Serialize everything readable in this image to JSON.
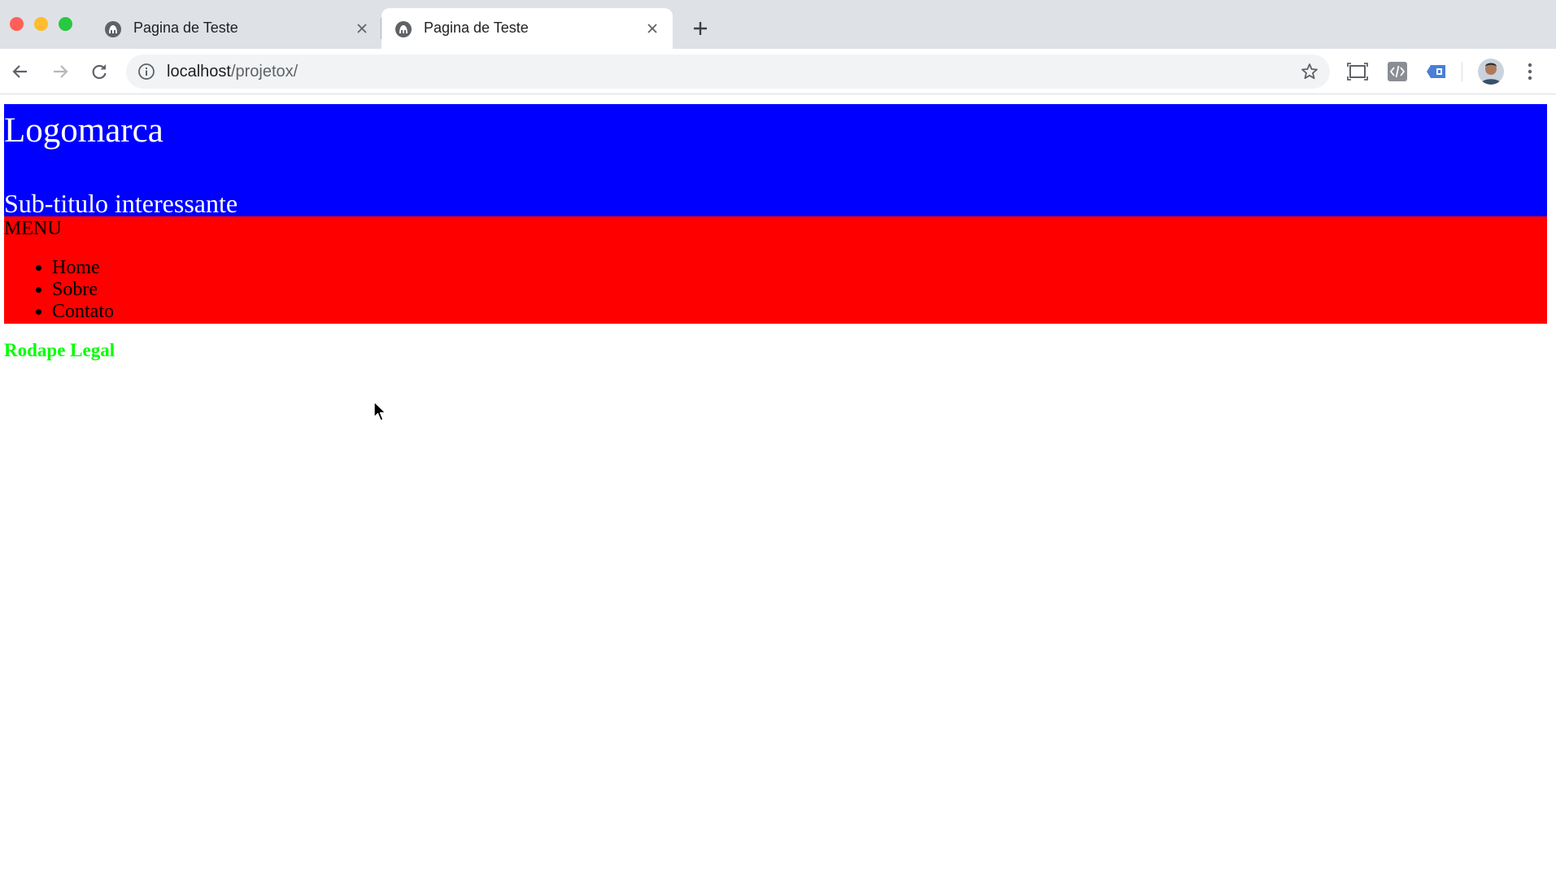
{
  "browser": {
    "tabs": [
      {
        "title": "Pagina de Teste",
        "active": false
      },
      {
        "title": "Pagina de Teste",
        "active": true
      }
    ],
    "address": {
      "host": "localhost",
      "path": "/projetox/"
    }
  },
  "page": {
    "header": {
      "logo": "Logomarca",
      "subtitle": "Sub-titulo interessante"
    },
    "nav": {
      "title": "MENU",
      "items": [
        {
          "label": "Home"
        },
        {
          "label": "Sobre"
        },
        {
          "label": "Contato"
        }
      ]
    },
    "footer": {
      "text": "Rodape Legal"
    }
  },
  "colors": {
    "header_bg": "#0000ff",
    "nav_bg": "#ff0000",
    "footer_text": "#00ff00"
  }
}
